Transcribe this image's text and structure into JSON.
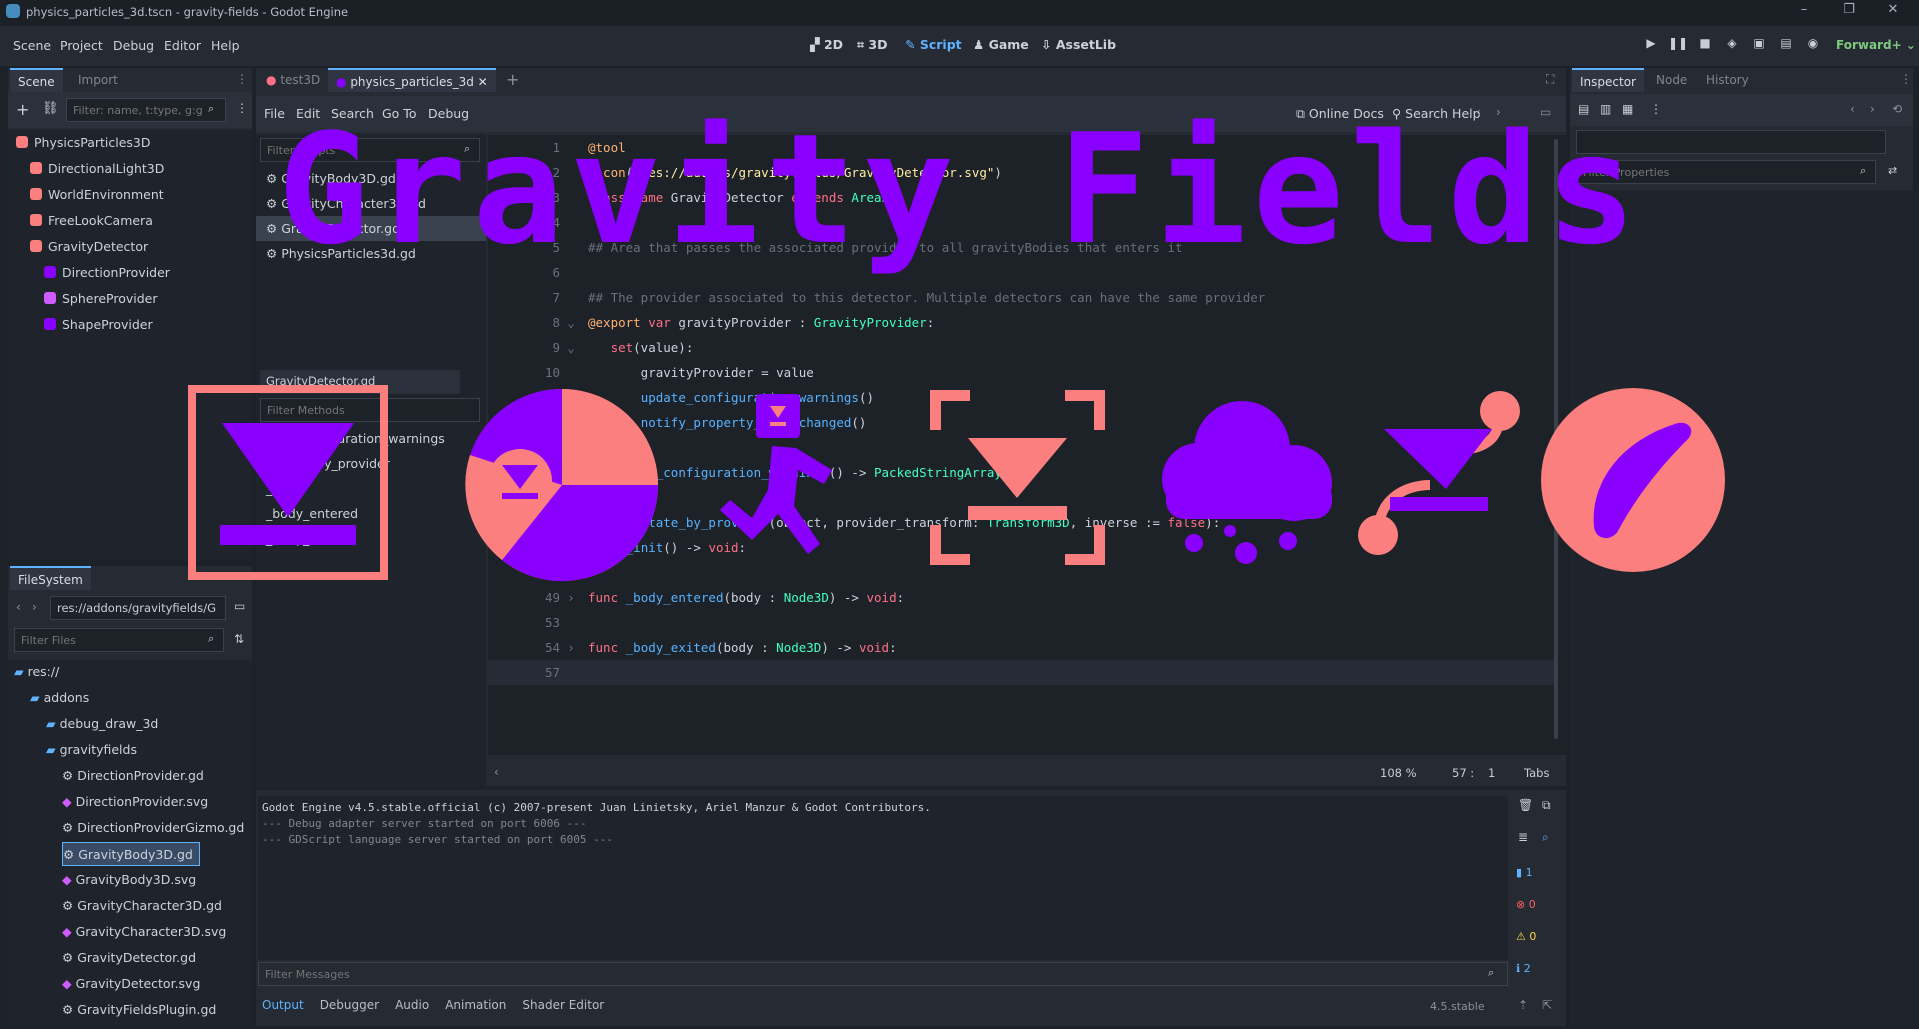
{
  "window": {
    "title": "physics_particles_3d.tscn - gravity-fields - Godot Engine",
    "controls": [
      "–",
      "❐",
      "✕"
    ]
  },
  "menubar": {
    "menus": [
      "Scene",
      "Project",
      "Debug",
      "Editor",
      "Help"
    ],
    "workspaces": [
      "2D",
      "3D",
      "Script",
      "Game",
      "AssetLib"
    ],
    "active_workspace": "Script",
    "renderer": "Forward+"
  },
  "scene_dock": {
    "tabs": [
      "Scene",
      "Import"
    ],
    "filter_placeholder": "Filter: name, t:type, g:g",
    "nodes": [
      {
        "name": "PhysicsParticles3D",
        "depth": 0,
        "color": "#fc7f7f"
      },
      {
        "name": "DirectionalLight3D",
        "depth": 1,
        "color": "#fc7f7f"
      },
      {
        "name": "WorldEnvironment",
        "depth": 1,
        "color": "#fc7f7f"
      },
      {
        "name": "FreeLookCamera",
        "depth": 1,
        "color": "#fc7f7f"
      },
      {
        "name": "GravityDetector",
        "depth": 1,
        "color": "#fc7f7f"
      },
      {
        "name": "DirectionProvider",
        "depth": 2,
        "color": "#8a00ff"
      },
      {
        "name": "SphereProvider",
        "depth": 2,
        "color": "#d05cff"
      },
      {
        "name": "ShapeProvider",
        "depth": 2,
        "color": "#8a00ff"
      }
    ]
  },
  "filesystem_dock": {
    "tab": "FileSystem",
    "path": "res://addons/gravityfields/G",
    "filter_placeholder": "Filter Files",
    "items": [
      {
        "name": "res://",
        "depth": 0
      },
      {
        "name": "addons",
        "depth": 1
      },
      {
        "name": "debug_draw_3d",
        "depth": 2
      },
      {
        "name": "gravityfields",
        "depth": 2
      },
      {
        "name": "DirectionProvider.gd",
        "depth": 3
      },
      {
        "name": "DirectionProvider.svg",
        "depth": 3
      },
      {
        "name": "DirectionProviderGizmo.gd",
        "depth": 3
      },
      {
        "name": "GravityBody3D.gd",
        "depth": 3
      },
      {
        "name": "GravityBody3D.svg",
        "depth": 3
      },
      {
        "name": "GravityCharacter3D.gd",
        "depth": 3
      },
      {
        "name": "GravityCharacter3D.svg",
        "depth": 3
      },
      {
        "name": "GravityDetector.gd",
        "depth": 3
      },
      {
        "name": "GravityDetector.svg",
        "depth": 3
      },
      {
        "name": "GravityFieldsPlugin.gd",
        "depth": 3
      }
    ],
    "selected": "GravityBody3D.gd"
  },
  "script_editor": {
    "scene_tabs": [
      "test3D",
      "physics_particles_3d"
    ],
    "menus": [
      "File",
      "Edit",
      "Search",
      "Go To",
      "Debug"
    ],
    "right_tools": [
      "Online Docs",
      "Search Help"
    ],
    "filter_scripts_placeholder": "Filter Scripts",
    "scripts": [
      "GravityBody3D.gd",
      "GravityCharacter3D.gd",
      "GravityDetector.gd",
      "PhysicsParticles3d.gd"
    ],
    "selected_script": "GravityDetector.gd",
    "filter_methods_placeholder": "Filter Methods",
    "methods": [
      "_get_configuration_warnings",
      "_rotate_by_provider",
      "_init",
      "_body_entered",
      "_body_exited"
    ],
    "status": {
      "zoom": "108 %",
      "line": "57 :",
      "col": "1",
      "indent": "Tabs"
    }
  },
  "code": [
    {
      "n": "1",
      "fold": "",
      "tokens": [
        [
          "an",
          "@tool"
        ]
      ]
    },
    {
      "n": "2",
      "fold": "",
      "tokens": [
        [
          "an",
          "@icon"
        ],
        [
          "pl",
          "("
        ],
        [
          "st",
          "\"res://addons/gravityfields/GravityDetector.svg\""
        ],
        [
          "pl",
          ")"
        ]
      ]
    },
    {
      "n": "3",
      "fold": "",
      "tokens": [
        [
          "kw",
          "class_name"
        ],
        [
          "pl",
          " GravityDetector "
        ],
        [
          "kw",
          "extends"
        ],
        [
          "pl",
          " "
        ],
        [
          "ty",
          "Area3D"
        ]
      ]
    },
    {
      "n": "4",
      "fold": "",
      "tokens": []
    },
    {
      "n": "5",
      "fold": "",
      "tokens": [
        [
          "cm",
          "## Area that passes the associated provider to all gravityBodies that enters it"
        ]
      ]
    },
    {
      "n": "6",
      "fold": "",
      "tokens": []
    },
    {
      "n": "7",
      "fold": "",
      "tokens": [
        [
          "cm",
          "## The provider associated to this detector. Multiple detectors can have the same provider"
        ]
      ]
    },
    {
      "n": "8",
      "fold": "⌄",
      "tokens": [
        [
          "an",
          "@export"
        ],
        [
          "pl",
          " "
        ],
        [
          "kw",
          "var"
        ],
        [
          "pl",
          " gravityProvider : "
        ],
        [
          "ty",
          "GravityProvider"
        ],
        [
          "pl",
          ":"
        ]
      ]
    },
    {
      "n": "9",
      "fold": "⌄",
      "tokens": [
        [
          "pl",
          "   "
        ],
        [
          "kw",
          "set"
        ],
        [
          "pl",
          "(value):"
        ]
      ]
    },
    {
      "n": "10",
      "fold": "",
      "tokens": [
        [
          "pl",
          "       gravityProvider = value"
        ]
      ]
    },
    {
      "n": "11",
      "fold": "",
      "tokens": [
        [
          "pl",
          "       "
        ],
        [
          "fn",
          "update_configuration_warnings"
        ],
        [
          "pl",
          "()"
        ]
      ]
    },
    {
      "n": "12",
      "fold": "",
      "tokens": [
        [
          "pl",
          "       "
        ],
        [
          "fn",
          "notify_property_list_changed"
        ],
        [
          "pl",
          "()"
        ]
      ]
    },
    {
      "n": "13",
      "fold": "",
      "tokens": []
    },
    {
      "n": "14",
      "fold": "›",
      "tokens": [
        [
          "kw",
          "func"
        ],
        [
          "pl",
          " "
        ],
        [
          "fn",
          "_get_configuration_warnings"
        ],
        [
          "pl",
          "() -> "
        ],
        [
          "ty",
          "PackedStringArray"
        ],
        [
          "pl",
          ":"
        ]
      ]
    },
    {
      "n": "27",
      "fold": "",
      "tokens": []
    },
    {
      "n": "28",
      "fold": "›",
      "tokens": [
        [
          "kw",
          "func"
        ],
        [
          "pl",
          " "
        ],
        [
          "fn",
          "_rotate_by_provider"
        ],
        [
          "pl",
          "(object, provider_transform: "
        ],
        [
          "ty",
          "Transform3D"
        ],
        [
          "pl",
          ", inverse := "
        ],
        [
          "kw",
          "false"
        ],
        [
          "pl",
          "):"
        ]
      ]
    },
    {
      "n": "44",
      "fold": "›",
      "tokens": [
        [
          "kw",
          "func"
        ],
        [
          "pl",
          " "
        ],
        [
          "fn",
          "_init"
        ],
        [
          "pl",
          "() -> "
        ],
        [
          "kw",
          "void"
        ],
        [
          "pl",
          ":"
        ]
      ]
    },
    {
      "n": "48",
      "fold": "",
      "tokens": []
    },
    {
      "n": "49",
      "fold": "›",
      "tokens": [
        [
          "kw",
          "func"
        ],
        [
          "pl",
          " "
        ],
        [
          "fn",
          "_body_entered"
        ],
        [
          "pl",
          "(body : "
        ],
        [
          "ty",
          "Node3D"
        ],
        [
          "pl",
          ") -> "
        ],
        [
          "kw",
          "void"
        ],
        [
          "pl",
          ":"
        ]
      ]
    },
    {
      "n": "53",
      "fold": "",
      "tokens": []
    },
    {
      "n": "54",
      "fold": "›",
      "tokens": [
        [
          "kw",
          "func"
        ],
        [
          "pl",
          " "
        ],
        [
          "fn",
          "_body_exited"
        ],
        [
          "pl",
          "(body : "
        ],
        [
          "ty",
          "Node3D"
        ],
        [
          "pl",
          ") -> "
        ],
        [
          "kw",
          "void"
        ],
        [
          "pl",
          ":"
        ]
      ]
    },
    {
      "n": "57",
      "fold": "",
      "tokens": []
    }
  ],
  "output": {
    "lines": [
      "Godot Engine v4.5.stable.official (c) 2007-present Juan Linietsky, Ariel Manzur & Godot Contributors.",
      "--- Debug adapter server started on port 6006 ---",
      "--- GDScript language server started on port 6005 ---"
    ],
    "filter_placeholder": "Filter Messages",
    "counts": [
      "1",
      "0",
      "0",
      "2"
    ],
    "bottom_tabs": [
      "Output",
      "Debugger",
      "Audio",
      "Animation",
      "Shader Editor"
    ],
    "version": "4.5.stable"
  },
  "inspector": {
    "tabs": [
      "Inspector",
      "Node",
      "History"
    ],
    "filter_placeholder": "Filter Properties"
  },
  "overlay": {
    "title": "Gravity Fields",
    "title_color": "#8a00ff",
    "accent_color": "#fc7f7f",
    "icons": [
      "direction-provider-icon",
      "gravity-body-icon",
      "gravity-character-icon",
      "gravity-detector-icon",
      "shape-provider-icon",
      "direction-provider-gizmo-icon",
      "sphere-provider-icon"
    ]
  }
}
